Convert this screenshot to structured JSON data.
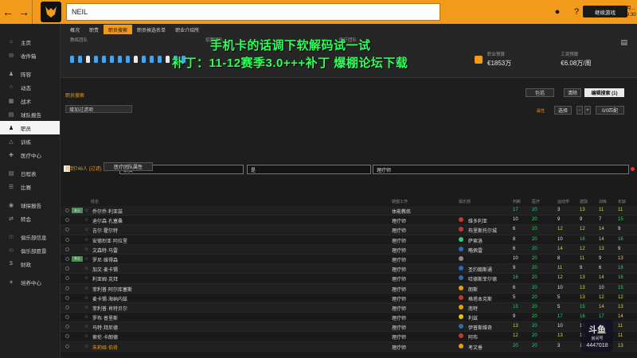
{
  "topbar": {
    "back_icon": "arrow-left-icon",
    "forward_icon": "arrow-right-icon",
    "search_value": "NEIL",
    "date_line1": "2020年9月...",
    "date_line2": "星期三 19:30",
    "continue_label": "继续游戏",
    "accent": "#f29a1b"
  },
  "sidebar": {
    "items": [
      {
        "label": "主页",
        "icon": "home-icon"
      },
      {
        "label": "收件箱",
        "icon": "inbox-icon"
      },
      {
        "label": "阵容",
        "icon": "squad-icon"
      },
      {
        "label": "动态",
        "icon": "dynamics-icon"
      },
      {
        "label": "战术",
        "icon": "tactics-icon"
      },
      {
        "label": "球队报告",
        "icon": "report-icon"
      },
      {
        "label": "职员",
        "icon": "staff-icon",
        "active": true
      },
      {
        "label": "训练",
        "icon": "training-icon"
      },
      {
        "label": "医疗中心",
        "icon": "medical-icon"
      },
      {
        "label": "日程表",
        "icon": "calendar-icon"
      },
      {
        "label": "比赛",
        "icon": "match-icon"
      },
      {
        "label": "球探报告",
        "icon": "scouting-icon"
      },
      {
        "label": "转会",
        "icon": "transfer-icon"
      },
      {
        "label": "俱乐部信息",
        "icon": "club-info-icon"
      },
      {
        "label": "俱乐部愿景",
        "icon": "vision-icon"
      },
      {
        "label": "财政",
        "icon": "finance-icon"
      },
      {
        "label": "培养中心",
        "icon": "development-icon"
      }
    ]
  },
  "tabs": [
    "概况",
    "职责",
    "职员搜索",
    "职员候选名单",
    "职业介绍所"
  ],
  "active_tab": 2,
  "header": {
    "label_a": "教练团队",
    "label_b": "招募团队",
    "label_c": "医疗团队",
    "finance_label1": "职业预算",
    "finance_value1": "€1853万",
    "finance_label2": "工资预算",
    "finance_value2": "€6.08万/周"
  },
  "overlay": {
    "line1": "手机卡的话调下软解码试一试",
    "line2": "补丁：11-12赛季3.0+++补丁 爆棚论坛下载"
  },
  "filters": {
    "section_label": "职员搜索",
    "add_filter": "增加过滤项",
    "include_label": "包括",
    "clear_label": "清除",
    "edit_search_label": "编辑搜索 (1)",
    "attr_label": "属性",
    "select_label": "选择",
    "match_label": "0/0匹配",
    "cond1": "职责",
    "cond2": "是",
    "cond3": "理疗师"
  },
  "results": {
    "found_label": "找到746人 (过滤)",
    "view_label": "医疗团队属性",
    "columns": [
      "姓名",
      "期望工作",
      "俱乐部",
      "判断",
      "医疗",
      "运动学",
      "激励",
      "训练",
      "年龄"
    ]
  },
  "rows": [
    {
      "name": "乔尔乔·利亚兹",
      "role": "体能教练",
      "club": "",
      "tag": "本土",
      "v": [
        "17",
        "20",
        "3",
        "13",
        "11",
        "11"
      ],
      "badge": ""
    },
    {
      "name": "迪尔森·孔塞桑",
      "role": "理疗师",
      "club": "维多利亚",
      "tag": "",
      "v": [
        "10",
        "20",
        "9",
        "9",
        "7",
        "15"
      ],
      "badge": "#c0392b"
    },
    {
      "name": "吉尔·霍尔特",
      "role": "理疗师",
      "club": "布里斯托尔城",
      "tag": "",
      "v": [
        "6",
        "20",
        "12",
        "12",
        "14",
        "9"
      ],
      "badge": "#c0392b"
    },
    {
      "name": "安德烈亚·阿拉里",
      "role": "理疗师",
      "club": "萨索洛",
      "tag": "",
      "v": [
        "8",
        "20",
        "10",
        "16",
        "14",
        "16"
      ],
      "badge": "#2ecc71"
    },
    {
      "name": "文森特·马雷",
      "role": "理疗师",
      "club": "略佩雷",
      "tag": "",
      "v": [
        "6",
        "20",
        "14",
        "12",
        "13",
        "9"
      ],
      "badge": "#2b6cb0"
    },
    {
      "name": "罗尼·维得森",
      "role": "理疗师",
      "club": "",
      "tag": "本土",
      "v": [
        "10",
        "20",
        "8",
        "11",
        "9",
        "13"
      ],
      "badge": "#888"
    },
    {
      "name": "加文·麦卡锡",
      "role": "理疗师",
      "club": "圣约翰斯通",
      "tag": "",
      "v": [
        "9",
        "20",
        "11",
        "9",
        "6",
        "18"
      ],
      "badge": "#2b6cb0"
    },
    {
      "name": "利亚姆·克拜",
      "role": "理疗师",
      "club": "哈德斯菲尔德",
      "tag": "",
      "v": [
        "16",
        "20",
        "12",
        "13",
        "14",
        "16"
      ],
      "badge": "#2b6cb0"
    },
    {
      "name": "菲利普·阿尔库塞斯",
      "role": "理疗师",
      "club": "朗斯",
      "tag": "",
      "v": [
        "6",
        "20",
        "10",
        "13",
        "10",
        "15"
      ],
      "badge": "#e5a000"
    },
    {
      "name": "麦卡锡·海纳内兹",
      "role": "理疗师",
      "club": "格塔本克斯",
      "tag": "",
      "v": [
        "5",
        "20",
        "5",
        "13",
        "12",
        "12"
      ],
      "badge": "#c0392b"
    },
    {
      "name": "菲利普·肖特贝尔",
      "role": "理疗师",
      "club": "南特",
      "tag": "",
      "v": [
        "15",
        "20",
        "5",
        "15",
        "14",
        "13"
      ],
      "badge": "#e5a000"
    },
    {
      "name": "罗布·普里斯",
      "role": "理疗师",
      "club": "利兹",
      "tag": "",
      "v": [
        "9",
        "20",
        "17",
        "16",
        "17",
        "14"
      ],
      "badge": "#e5c400"
    },
    {
      "name": "马特·拜尼德",
      "role": "理疗师",
      "club": "伊普斯维奇",
      "tag": "",
      "v": [
        "13",
        "20",
        "10",
        "10",
        "14",
        "11"
      ],
      "badge": "#2b6cb0"
    },
    {
      "name": "索伦·卡朗德",
      "role": "理疗师",
      "club": "阿布",
      "tag": "",
      "v": [
        "12",
        "20",
        "13",
        "13",
        "11",
        "11"
      ],
      "badge": "#c0392b"
    },
    {
      "name": "朱莉娅·伯奇",
      "role": "理疗师",
      "club": "考文垂",
      "tag": "",
      "v": [
        "20",
        "20",
        "3",
        "13",
        "13",
        "13"
      ],
      "badge": "#e5a000",
      "highlight": true
    }
  ],
  "watermark": {
    "logo": "斗鱼",
    "sub": "房间号",
    "number": "4447018"
  }
}
